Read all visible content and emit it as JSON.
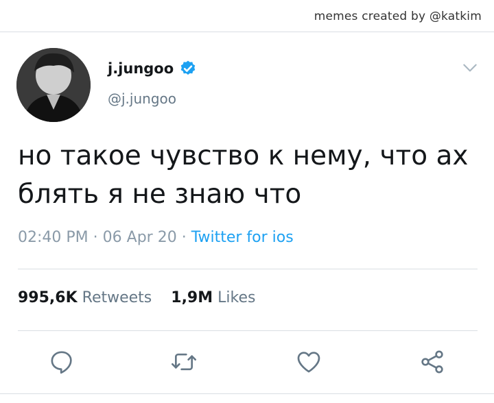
{
  "credit": "memes created by @katkim",
  "tweet": {
    "display_name": "j.jungoo",
    "handle": "@j.jungoo",
    "text_line1": "но такое чувство к нему, что ах",
    "text_line2": "блять я не знаю что",
    "time": "02:40 PM",
    "date": "06 Apr 20",
    "source": "Twitter for ios",
    "retweets_count": "995,6K",
    "retweets_label": "Retweets",
    "likes_count": "1,9M",
    "likes_label": "Likes"
  },
  "icons": {
    "verified": "verified-badge-icon",
    "menu": "chevron-down-icon",
    "reply": "reply-icon",
    "retweet": "retweet-icon",
    "like": "heart-icon",
    "share": "share-icon"
  },
  "colors": {
    "accent": "#1da1f2",
    "text": "#14171a",
    "muted": "#657786",
    "divider": "#d9dee3"
  }
}
